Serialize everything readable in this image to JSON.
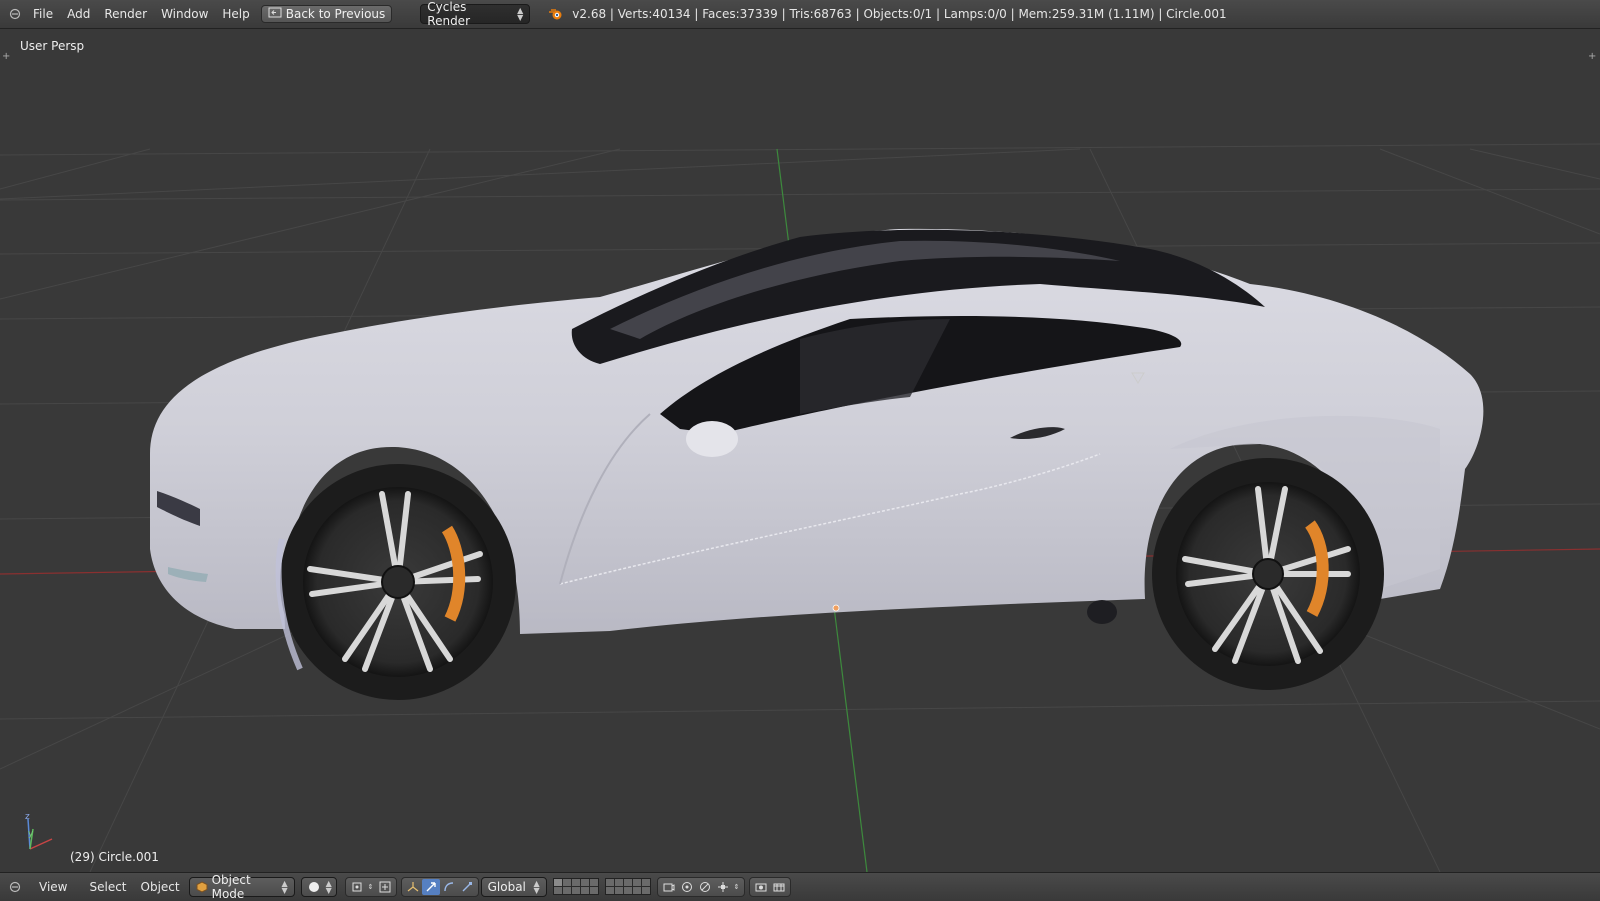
{
  "header": {
    "menus": [
      "File",
      "Add",
      "Render",
      "Window",
      "Help"
    ],
    "back_button": "Back to Previous",
    "render_engine": "Cycles Render",
    "stats": "v2.68 | Verts:40134 | Faces:37339 | Tris:68763 | Objects:0/1 | Lamps:0/0 | Mem:259.31M (1.11M) | Circle.001"
  },
  "viewport": {
    "view_name": "User Persp",
    "object_info": "(29) Circle.001",
    "axis_labels": {
      "z": "z",
      "y": "y"
    }
  },
  "footer": {
    "menus": [
      "View",
      "Select",
      "Object"
    ],
    "mode": "Object Mode",
    "orientation": "Global"
  },
  "colors": {
    "accent": "#5680c2",
    "grid": "#474747",
    "x_axis": "#8a3030",
    "y_axis": "#3d8a3d",
    "car_body": "#d6d6de"
  }
}
